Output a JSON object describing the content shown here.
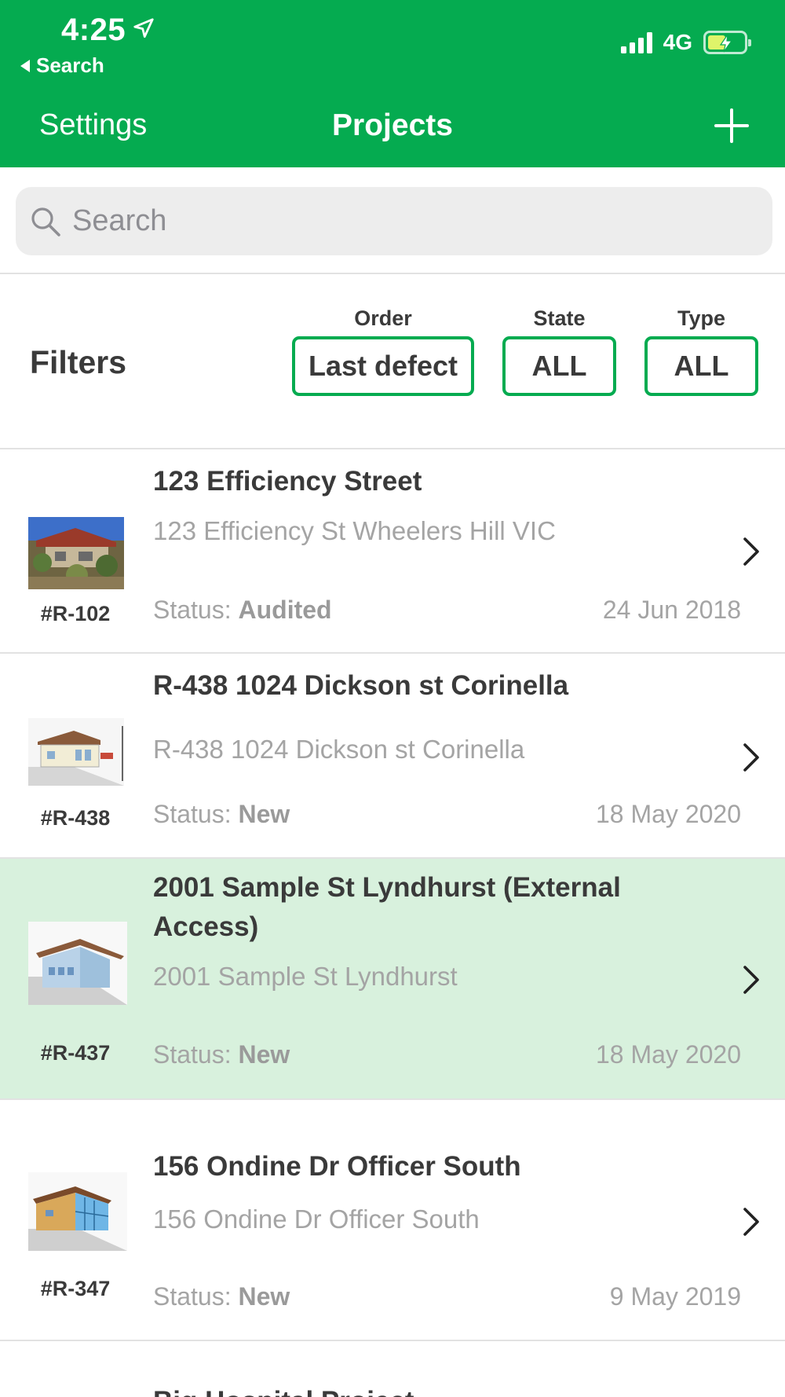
{
  "status_bar": {
    "time": "4:25",
    "back_label": "Search",
    "network": "4G"
  },
  "nav": {
    "left": "Settings",
    "title": "Projects",
    "add_icon": "plus-icon"
  },
  "search": {
    "placeholder": "Search"
  },
  "filters": {
    "label": "Filters",
    "order": {
      "caption": "Order",
      "value": "Last defect"
    },
    "state": {
      "caption": "State",
      "value": "ALL"
    },
    "type": {
      "caption": "Type",
      "value": "ALL"
    }
  },
  "projects": [
    {
      "code": "#R-102",
      "title": "123 Efficiency Street",
      "address": "123 Efficiency St Wheelers Hill VIC",
      "status_label": "Status:",
      "status": "Audited",
      "date": "24 Jun 2018",
      "thumb": "house-photo"
    },
    {
      "code": "#R-438",
      "title": "R-438 1024 Dickson st Corinella",
      "address": "R-438 1024 Dickson st Corinella",
      "status_label": "Status:",
      "status": "New",
      "date": "18 May 2020",
      "thumb": "house-3d-model"
    },
    {
      "code": "#R-437",
      "title": "2001 Sample St Lyndhurst (External Access)",
      "address": "2001 Sample St Lyndhurst",
      "status_label": "Status:",
      "status": "New",
      "date": "18 May 2020",
      "thumb": "house-3d-model",
      "selected": true
    },
    {
      "code": "#R-347",
      "title": "156 Ondine Dr Officer South",
      "address": "156 Ondine Dr Officer South",
      "status_label": "Status:",
      "status": "New",
      "date": "9 May 2019",
      "thumb": "house-3d-model"
    },
    {
      "title": "Big Hospital Project"
    }
  ],
  "colors": {
    "brand_green": "#05ab50",
    "selected_row": "#d8f1dd"
  }
}
